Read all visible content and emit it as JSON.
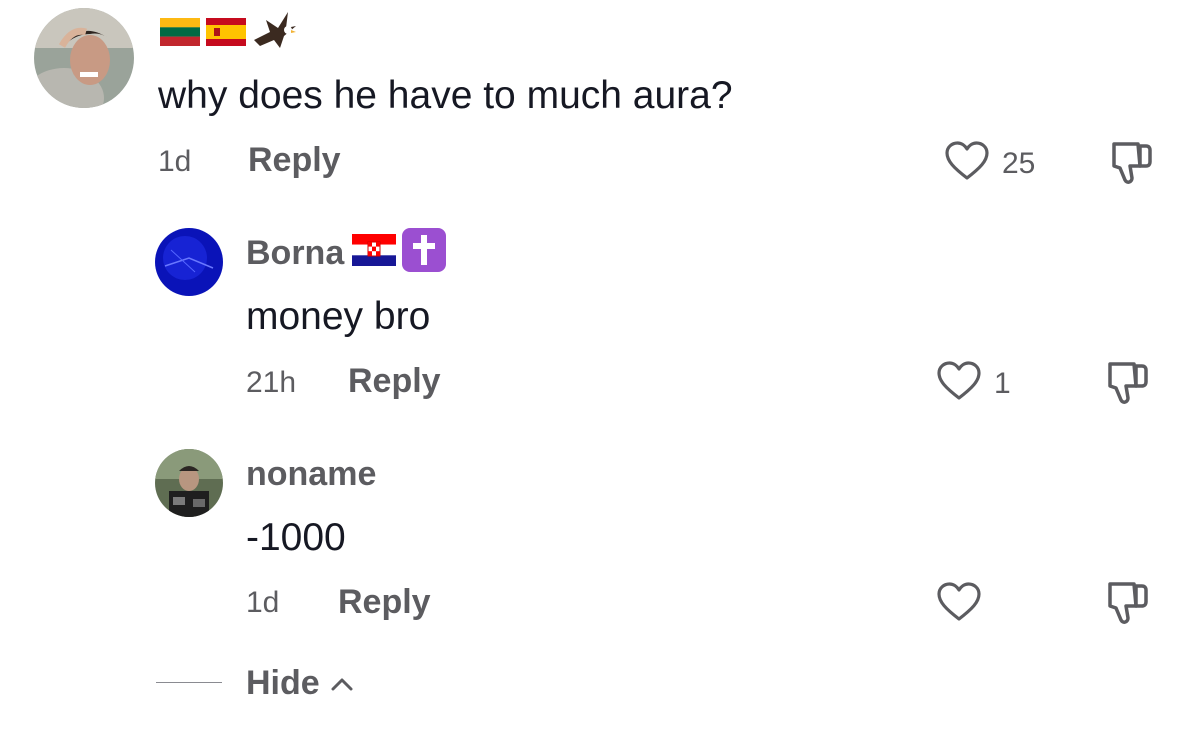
{
  "comment": {
    "badges": [
      "flag-lithuania-icon",
      "flag-spain-icon",
      "eagle-icon"
    ],
    "text": "why does he have to much aura?",
    "time": "1d",
    "reply_label": "Reply",
    "likes": "25"
  },
  "replies": [
    {
      "username": "Borna",
      "badges": [
        "flag-croatia-icon",
        "latin-cross-icon"
      ],
      "text": "money bro",
      "time": "21h",
      "reply_label": "Reply",
      "likes": "1"
    },
    {
      "username": "noname",
      "text": "-1000",
      "time": "1d",
      "reply_label": "Reply",
      "likes": ""
    }
  ],
  "hide_label": "Hide",
  "colors": {
    "text_primary": "#161823",
    "text_secondary": "#5c5c60",
    "icon": "#5c5c60",
    "cross_badge": "#9b4fd1"
  }
}
